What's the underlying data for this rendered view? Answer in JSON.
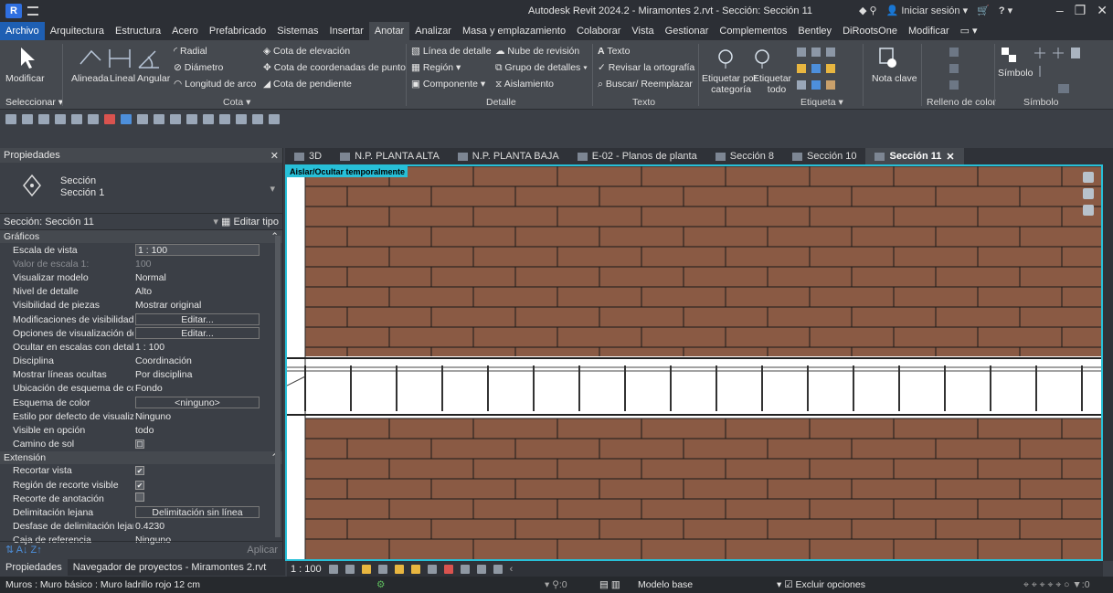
{
  "app": {
    "logo": "R",
    "title": "Autodesk Revit 2024.2 - Miramontes 2.rvt - Sección: Sección 11",
    "signin": "Iniciar sesión",
    "help": "?"
  },
  "menu": [
    "Archivo",
    "Arquitectura",
    "Estructura",
    "Acero",
    "Prefabricado",
    "Sistemas",
    "Insertar",
    "Anotar",
    "Analizar",
    "Masa y emplazamiento",
    "Colaborar",
    "Vista",
    "Gestionar",
    "Complementos",
    "Bentley",
    "DiRootsOne",
    "Modificar"
  ],
  "ribbon": {
    "modify": "Modificar",
    "select_panel": "Seleccionar",
    "dims": {
      "aligned": "Alineada",
      "linear": "Lineal",
      "angular": "Angular",
      "radial": "Radial",
      "diameter": "Diámetro",
      "arc_length": "Longitud de arco",
      "spot_elev": "Cota de elevación",
      "spot_coord": "Cota de coordenadas de punto",
      "spot_slope": "Cota de pendiente",
      "panel": "Cota"
    },
    "detail": {
      "detail_line": "Línea de detalle",
      "region": "Región",
      "component": "Componente",
      "revision_cloud": "Nube de revisión",
      "detail_group": "Grupo de detalles",
      "insulation": "Aislamiento",
      "panel": "Detalle"
    },
    "text": {
      "text": "Texto",
      "spelling": "Revisar la ortografía",
      "find_replace": "Buscar/ Reemplazar",
      "panel": "Texto"
    },
    "tag": {
      "by_category_1": "Etiquetar por",
      "by_category_2": "categoría",
      "all_1": "Etiquetar",
      "all_2": "todo",
      "panel": "Etiqueta"
    },
    "keynote": "Nota clave",
    "color_fill_panel": "Relleno de color",
    "symbol": "Símbolo",
    "symbol_panel": "Símbolo"
  },
  "properties": {
    "header": "Propiedades",
    "type_name_1": "Sección",
    "type_name_2": "Sección 1",
    "instance": "Sección: Sección 11",
    "edit_type": "Editar tipo",
    "groups": [
      {
        "name": "Gráficos",
        "rows": [
          {
            "name": "Escala de vista",
            "value": "1 : 100",
            "style": "boxl"
          },
          {
            "name": "Valor de escala    1:",
            "value": "100",
            "muted": true
          },
          {
            "name": "Visualizar modelo",
            "value": "Normal"
          },
          {
            "name": "Nivel de detalle",
            "value": "Alto"
          },
          {
            "name": "Visibilidad de piezas",
            "value": "Mostrar original"
          },
          {
            "name": "Modificaciones de visibilidad...",
            "value": "Editar...",
            "style": "box"
          },
          {
            "name": "Opciones de visualización de ...",
            "value": "Editar...",
            "style": "box"
          },
          {
            "name": "Ocultar en escalas con detalle...",
            "value": "1 : 100"
          },
          {
            "name": "Disciplina",
            "value": "Coordinación"
          },
          {
            "name": "Mostrar líneas ocultas",
            "value": "Por disciplina"
          },
          {
            "name": "Ubicación de esquema de col...",
            "value": "Fondo"
          },
          {
            "name": "Esquema de color",
            "value": "<ninguno>",
            "style": "box"
          },
          {
            "name": "Estilo por defecto de visualiz...",
            "value": "Ninguno"
          },
          {
            "name": "Visible en opción",
            "value": "todo"
          },
          {
            "name": "Camino de sol",
            "value": "☐",
            "style": "chk0"
          }
        ]
      },
      {
        "name": "Extensión",
        "rows": [
          {
            "name": "Recortar vista",
            "value": "✔",
            "style": "chk1"
          },
          {
            "name": "Región de recorte visible",
            "value": "✔",
            "style": "chk1"
          },
          {
            "name": "Recorte de anotación",
            "value": "",
            "style": "chk0"
          },
          {
            "name": "Delimitación lejana",
            "value": "Delimitación sin línea",
            "style": "box"
          },
          {
            "name": "Desfase de delimitación lejano",
            "value": "0.4230"
          },
          {
            "name": "Caja de referencia",
            "value": "Ninguno"
          }
        ]
      }
    ],
    "apply": "Aplicar"
  },
  "bottom_tabs": [
    "Propiedades",
    "Navegador de proyectos - Miramontes 2.rvt"
  ],
  "view_tabs": [
    {
      "label": "3D"
    },
    {
      "label": "N.P. PLANTA ALTA"
    },
    {
      "label": "N.P. PLANTA BAJA"
    },
    {
      "label": "E-02 - Planos de planta"
    },
    {
      "label": "Sección 8"
    },
    {
      "label": "Sección 10"
    },
    {
      "label": "Sección 11",
      "active": true
    }
  ],
  "canvas": {
    "isolate_label": "Aislar/Ocultar temporalmente",
    "scale": "1 : 100"
  },
  "status": {
    "selection": "Muros : Muro básico : Muro ladrillo rojo 12 cm",
    "zero": ":0",
    "model": "Modelo base",
    "exclude": "Excluir opciones",
    "filter_count": ":0"
  },
  "colors": {
    "brick": "#8a5a44",
    "mortar": "#1a1a1a",
    "crop": "#27c0d8",
    "accent": "#1e5fb3"
  }
}
